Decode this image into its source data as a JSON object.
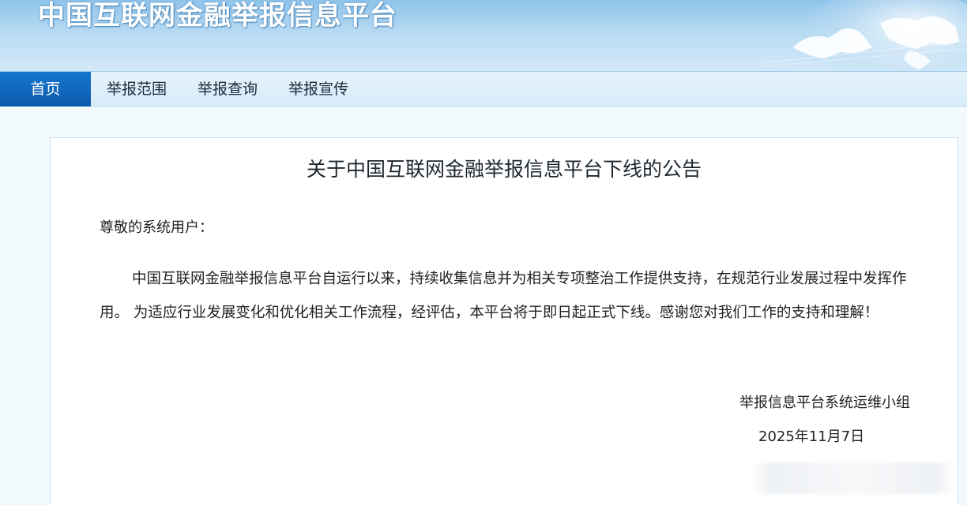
{
  "header": {
    "site_title": "中国互联网金融举报信息平台"
  },
  "nav": {
    "items": [
      {
        "label": "首页",
        "active": true
      },
      {
        "label": "举报范围",
        "active": false
      },
      {
        "label": "举报查询",
        "active": false
      },
      {
        "label": "举报宣传",
        "active": false
      }
    ]
  },
  "notice": {
    "title": "关于中国互联网金融举报信息平台下线的公告",
    "salutation": "尊敬的系统用户：",
    "body": "中国互联网金融举报信息平台自运行以来，持续收集信息并为相关专项整治工作提供支持，在规范行业发展过程中发挥作用。 为适应行业发展变化和优化相关工作流程，经评估，本平台将于即日起正式下线。感谢您对我们工作的支持和理解！",
    "signature": "举报信息平台系统运维小组",
    "date": "2025年11月7日"
  },
  "colors": {
    "nav_active": "#0b5aad",
    "banner": "#8fc3ea",
    "page_bg": "#f2f9fd"
  },
  "icons": {
    "banner_graphic": "world-map-globe"
  }
}
